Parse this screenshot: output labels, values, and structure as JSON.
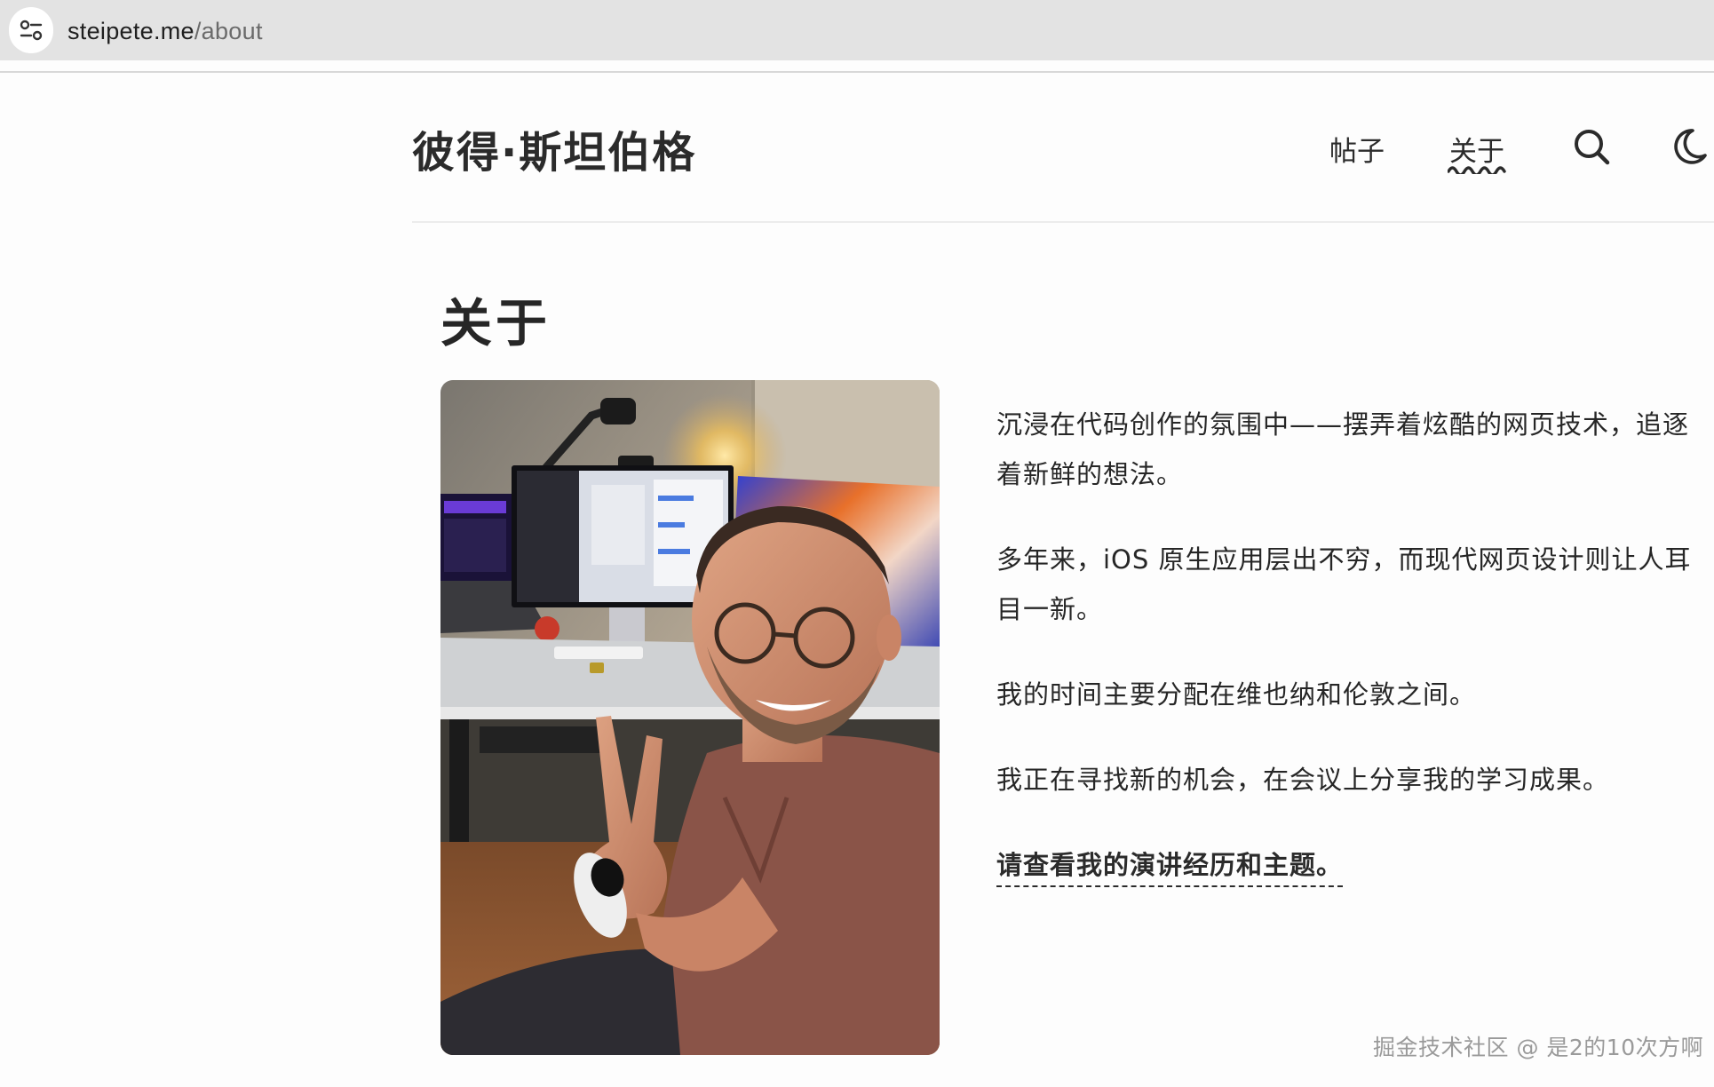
{
  "browser": {
    "url_host": "steipete.me",
    "url_path": "/about"
  },
  "header": {
    "site_title": "彼得·斯坦伯格",
    "nav": [
      {
        "label": "帖子",
        "active": false
      },
      {
        "label": "关于",
        "active": true
      }
    ],
    "icons": [
      "search-icon",
      "moon-icon"
    ]
  },
  "main": {
    "title": "关于",
    "photo_alt": "photo-of-author-at-desk",
    "paragraphs": [
      "沉浸在代码创作的氛围中——摆弄着炫酷的网页技术，追逐着新鲜的想法。",
      "多年来，iOS 原生应用层出不穷，而现代网页设计则让人耳目一新。",
      "我的时间主要分配在维也纳和伦敦之间。",
      "我正在寻找新的机会，在会议上分享我的学习成果。"
    ],
    "talks_link": "请查看我的演讲经历和主题。"
  },
  "watermark": "掘金技术社区 @ 是2的10次方啊",
  "colors": {
    "text": "#262626",
    "address_bar": "#e3e3e3",
    "muted": "#6b6b6b"
  }
}
